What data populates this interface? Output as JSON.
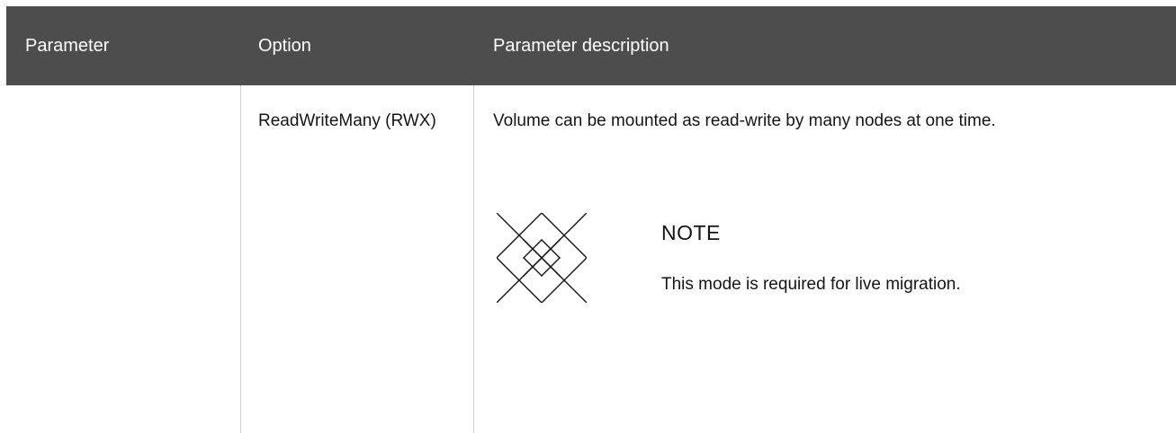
{
  "table": {
    "headers": {
      "parameter": "Parameter",
      "option": "Option",
      "description": "Parameter description"
    },
    "row": {
      "parameter": "",
      "option": "ReadWriteMany (RWX)",
      "description": "Volume can be mounted as read-write by many nodes at one time.",
      "note": {
        "icon": "note-diamond-lattice-icon",
        "title": "NOTE",
        "text": "This mode is required for live migration."
      }
    }
  },
  "colors": {
    "header_background": "#4d4d4d",
    "header_text": "#ffffff",
    "body_text": "#151515",
    "divider": "#d2d2d2"
  }
}
